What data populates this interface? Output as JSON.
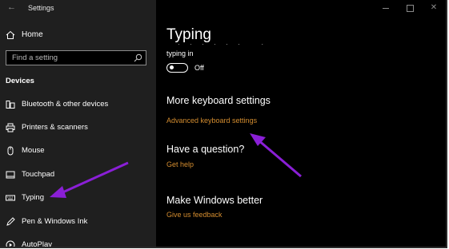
{
  "window": {
    "app_title": "Settings"
  },
  "sidebar": {
    "home_label": "Home",
    "search_placeholder": "Find a setting",
    "section_title": "Devices",
    "items": [
      {
        "label": "Bluetooth & other devices",
        "icon": "bluetooth-devices-icon"
      },
      {
        "label": "Printers & scanners",
        "icon": "printer-icon"
      },
      {
        "label": "Mouse",
        "icon": "mouse-icon"
      },
      {
        "label": "Touchpad",
        "icon": "touchpad-icon"
      },
      {
        "label": "Typing",
        "icon": "keyboard-icon"
      },
      {
        "label": "Pen & Windows Ink",
        "icon": "pen-icon"
      },
      {
        "label": "AutoPlay",
        "icon": "autoplay-icon"
      }
    ]
  },
  "main": {
    "title": "Typing",
    "partial_text": "' . . . . . . ' .",
    "setting_label": "typing in",
    "toggle_state": "Off",
    "more_keyboard": {
      "heading": "More keyboard settings",
      "link": "Advanced keyboard settings"
    },
    "question": {
      "heading": "Have a question?",
      "link": "Get help"
    },
    "better": {
      "heading": "Make Windows better",
      "link": "Give us feedback"
    }
  },
  "colors": {
    "sidebar_bg": "#1f1f1f",
    "content_bg": "#000000",
    "link": "#d38c2f",
    "annotation_arrow": "#8a1fd6"
  }
}
